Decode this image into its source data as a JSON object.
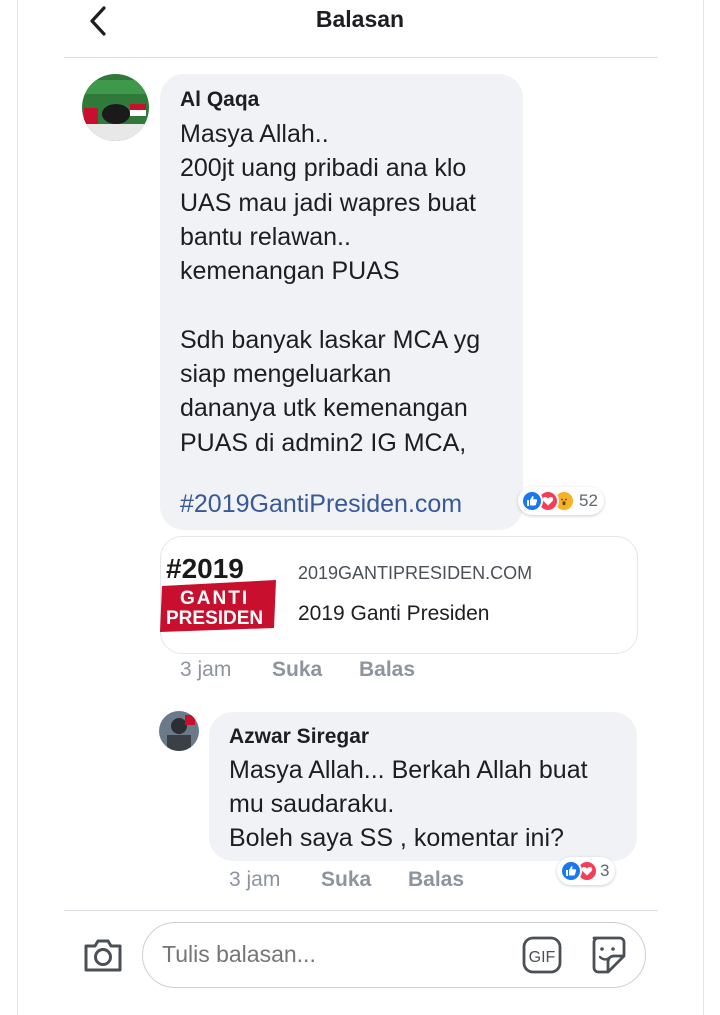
{
  "header": {
    "title": "Balasan"
  },
  "comment": {
    "author": "Al Qaqa",
    "text": "Masya Allah..\n200jt uang pribadi ana klo\nUAS mau jadi wapres buat\nbantu relawan..\nkemenangan PUAS\n\nSdh banyak laskar MCA yg\nsiap mengeluarkan\ndananya utk kemenangan\nPUAS di admin2 IG MCA,",
    "hashtag": "#2019GantiPresiden.com",
    "reaction_count": "52",
    "link": {
      "logo_line1": "#2019",
      "logo_line2": "GANTI",
      "logo_line3": "PRESIDEN",
      "domain": "2019GANTIPRESIDEN.COM",
      "title": "2019 Ganti Presiden"
    },
    "time": "3 jam",
    "like_label": "Suka",
    "reply_label": "Balas"
  },
  "reply": {
    "author": "Azwar Siregar",
    "text": "Masya Allah... Berkah Allah buat\nmu saudaraku.\nBoleh saya SS , komentar ini?",
    "reaction_count": "3",
    "time": "3 jam",
    "like_label": "Suka",
    "reply_label": "Balas"
  },
  "composer": {
    "placeholder": "Tulis balasan...",
    "gif_label": "GIF"
  },
  "colors": {
    "like_blue": "#1877f2",
    "love_red": "#f33e58",
    "wow_yellow": "#f7b125",
    "link_blue": "#385898",
    "logo_red": "#c8102e"
  }
}
